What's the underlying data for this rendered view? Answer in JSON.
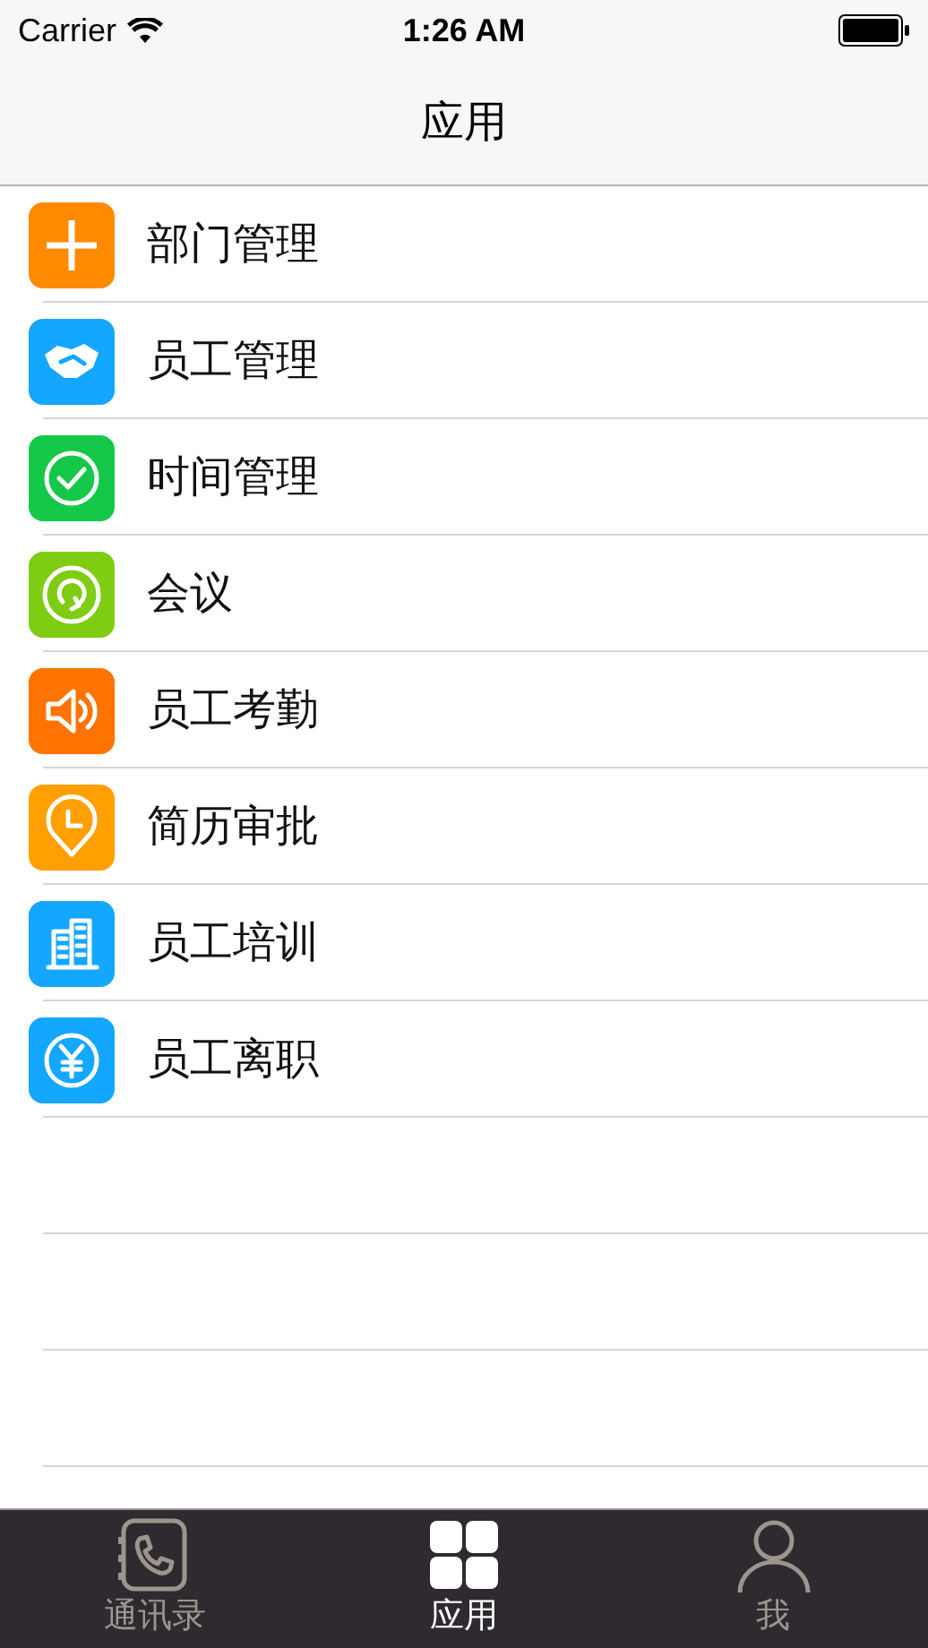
{
  "status_bar": {
    "carrier": "Carrier",
    "time": "1:26 AM"
  },
  "nav_bar": {
    "title": "应用"
  },
  "items": [
    {
      "label": "部门管理",
      "kind": "plus",
      "color": "#ff8a00"
    },
    {
      "label": "员工管理",
      "kind": "handshake",
      "color": "#13a7ff"
    },
    {
      "label": "时间管理",
      "kind": "check",
      "color": "#16c84a"
    },
    {
      "label": "会议",
      "kind": "refresh",
      "color": "#7fcd12"
    },
    {
      "label": "员工考勤",
      "kind": "speaker",
      "color": "#ff7400"
    },
    {
      "label": "简历审批",
      "kind": "pin",
      "color": "#ffa000"
    },
    {
      "label": "员工培训",
      "kind": "building",
      "color": "#13a7ff"
    },
    {
      "label": "员工离职",
      "kind": "yen",
      "color": "#13a7ff"
    }
  ],
  "tabs": [
    {
      "label": "通讯录",
      "kind": "phone",
      "selected": false
    },
    {
      "label": "应用",
      "kind": "grid",
      "selected": true
    },
    {
      "label": "我",
      "kind": "person",
      "selected": false
    }
  ]
}
